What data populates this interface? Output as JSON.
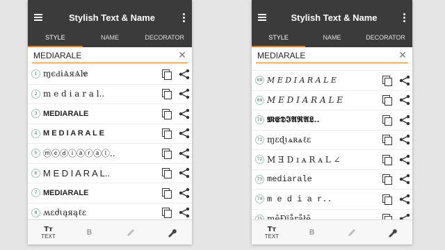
{
  "app": {
    "title": "Stylish Text & Name",
    "tabs": [
      "STYLE",
      "NAME",
      "DECORATOR"
    ],
    "active_tab": "STYLE",
    "accent_color": "#e67e22",
    "toolbar_color": "#3b3b3b"
  },
  "left": {
    "search_value": "MEDIARALE",
    "rows": [
      {
        "num": "1",
        "text": "ɱєԀɨѦяѦŀɇ"
      },
      {
        "num": "2",
        "text": "m e d i a r a l.."
      },
      {
        "num": "3",
        "text": "MEDIARALE"
      },
      {
        "num": "4",
        "text": "M E D I A R A L E"
      },
      {
        "num": "5",
        "text": "ⓜⓔⓓⓘⓐⓡⓐⓛ.."
      },
      {
        "num": "6",
        "text": "M E D I A R A L.."
      },
      {
        "num": "7",
        "text": "MEDIARALE"
      },
      {
        "num": "8",
        "text": "ʍɛძɩąяąℓɛ"
      }
    ]
  },
  "right": {
    "search_value": "MEDIARALE",
    "rows": [
      {
        "num": "68",
        "text": "M E D I A R A L E"
      },
      {
        "num": "69",
        "text": "M E D I A R A L E"
      },
      {
        "num": "70",
        "text": "𝕸𝕰𝕯𝕴𝕬𝕽𝕬𝕷.."
      },
      {
        "num": "71",
        "text": "ɱɛɖɩѧʀѧℓɛ"
      },
      {
        "num": "72",
        "text": "M Ǝ D ɪ ᴀ R ᴀ L ∠"
      },
      {
        "num": "73",
        "text": "mediarale"
      },
      {
        "num": "74",
        "text": "m e d i a r.."
      },
      {
        "num": "75",
        "text": "mêĐïåŗåłê"
      }
    ]
  },
  "bottom": {
    "text_icon": "Tт",
    "text_label": "TEXT",
    "bold_icon": "B"
  },
  "icons": {
    "menu": "hamburger-menu-icon",
    "more": "more-vert-icon",
    "clear": "close-icon",
    "copy": "copy-icon",
    "share": "share-icon",
    "edit": "pencil-icon",
    "settings": "wrench-icon"
  }
}
